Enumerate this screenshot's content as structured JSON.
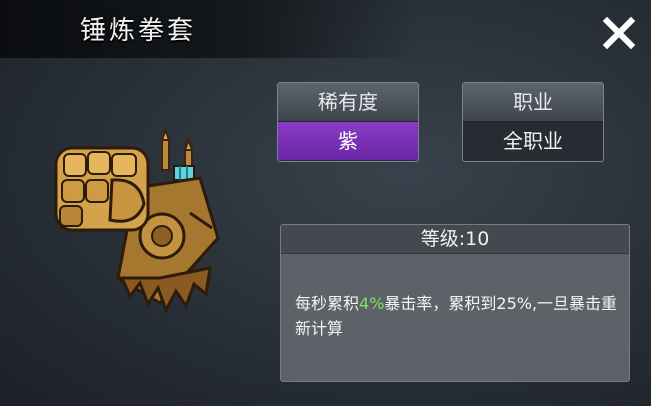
{
  "window": {
    "title": "锤炼拳套",
    "close_icon": "close-icon"
  },
  "item": {
    "icon": "gauntlet-icon"
  },
  "rarity": {
    "label": "稀有度",
    "value": "紫",
    "color": "#7b33b8"
  },
  "job": {
    "label": "职业",
    "value": "全职业"
  },
  "level": {
    "label": "等级:10"
  },
  "description": {
    "part1": "每秒累积",
    "highlight": "4%",
    "part2": "暴击率，累积到25%,一旦暴击重新计算",
    "highlight_color": "#7ee05b"
  }
}
